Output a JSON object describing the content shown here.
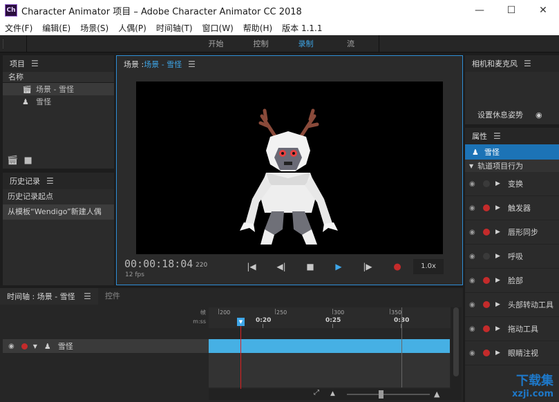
{
  "window": {
    "app_icon": "Ch",
    "title": "Character Animator 项目 – Adobe Character Animator CC 2018",
    "minimize": "—",
    "maximize": "☐",
    "close": "✕"
  },
  "menubar": {
    "items": [
      "文件(F)",
      "编辑(E)",
      "场景(S)",
      "人偶(P)",
      "时间轴(T)",
      "窗口(W)",
      "帮助(H)",
      "版本 1.1.1"
    ]
  },
  "workspace": {
    "tabs": [
      "开始",
      "控制",
      "录制",
      "流"
    ],
    "active": "录制"
  },
  "project": {
    "title": "项目",
    "column_name": "名称",
    "items": [
      {
        "icon": "clapper-icon",
        "label": "场景 - 雪怪"
      },
      {
        "icon": "puppet-icon",
        "label": "雪怪"
      }
    ]
  },
  "history": {
    "title": "历史记录",
    "items": [
      "历史记录起点",
      "从模板“Wendigo”新建人偶"
    ]
  },
  "scene": {
    "title_prefix": "场景 : ",
    "title_name": "场景 - 雪怪",
    "timecode": "00:00:18:04",
    "fps": "12 fps",
    "frame": "220",
    "speed": "1.0x"
  },
  "camera": {
    "title": "相机和麦克风",
    "rest_pose": "设置休息姿势"
  },
  "properties": {
    "title": "属性",
    "selected": "雪怪",
    "section": "轨道项目行为",
    "behaviors": [
      {
        "label": "变换",
        "armed": false
      },
      {
        "label": "触发器",
        "armed": true
      },
      {
        "label": "唇形同步",
        "armed": true
      },
      {
        "label": "呼吸",
        "armed": false
      },
      {
        "label": "脸部",
        "armed": true
      },
      {
        "label": "头部转动工具",
        "armed": true
      },
      {
        "label": "拖动工具",
        "armed": true
      },
      {
        "label": "眼睛注视",
        "armed": true
      }
    ]
  },
  "timeline": {
    "tab_active": "时间轴 : 场景 - 雪怪",
    "tab_inactive": "控件",
    "frame_label": "帧",
    "time_label": "m:ss",
    "frame_ticks": [
      "200",
      "250",
      "300",
      "350"
    ],
    "time_ticks": [
      "0:20",
      "0:25",
      "0:30"
    ],
    "track_name": "雪怪"
  },
  "watermark": {
    "main": "下载集",
    "sub": "xzji.com"
  },
  "colors": {
    "accent": "#3ea6e8",
    "selection": "#1c73b6",
    "record": "#c42b2b"
  }
}
